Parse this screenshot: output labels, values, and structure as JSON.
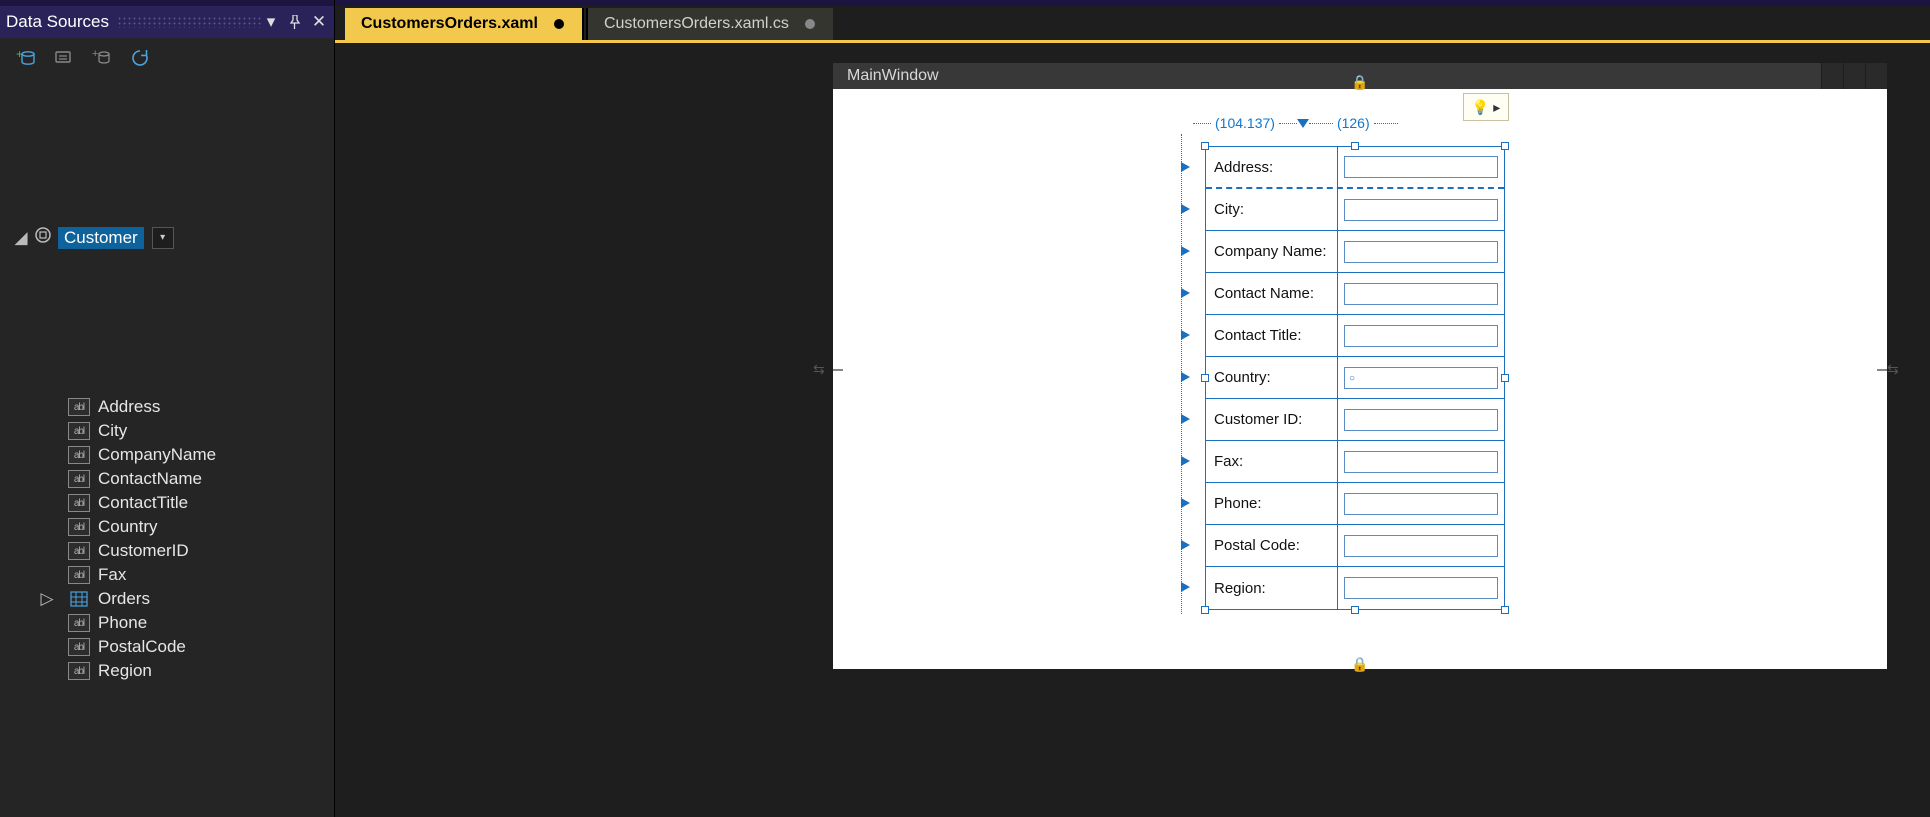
{
  "panel": {
    "title": "Data Sources",
    "rootNode": "Customer",
    "fields": [
      "Address",
      "City",
      "CompanyName",
      "ContactName",
      "ContactTitle",
      "Country",
      "CustomerID",
      "Fax",
      "Orders",
      "Phone",
      "PostalCode",
      "Region"
    ]
  },
  "tabs": {
    "active": "CustomersOrders.xaml",
    "inactive": "CustomersOrders.xaml.cs"
  },
  "designer": {
    "windowTitle": "MainWindow",
    "col1Width": "(104.137)",
    "col2Width": "(126)",
    "formLabels": [
      "Address:",
      "City:",
      "Company Name:",
      "Contact Name:",
      "Contact Title:",
      "Country:",
      "Customer ID:",
      "Fax:",
      "Phone:",
      "Postal Code:",
      "Region:"
    ]
  }
}
